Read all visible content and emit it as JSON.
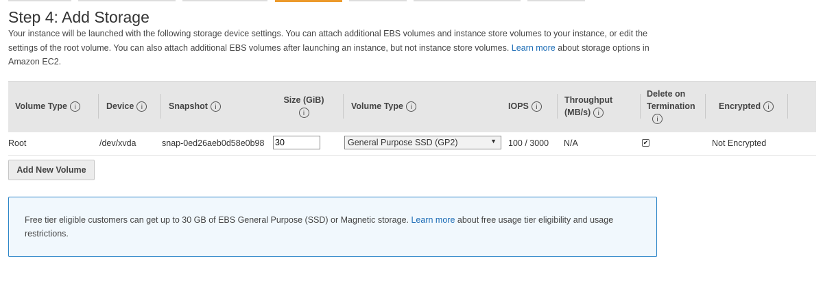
{
  "wizard": {
    "step_title": "Step 4: Add Storage",
    "description_part1": "Your instance will be launched with the following storage device settings. You can attach additional EBS volumes and instance store volumes to your instance, or edit the settings of the root volume. You can also attach additional EBS volumes after launching an instance, but not instance store volumes.",
    "learn_more_link": "Learn more",
    "description_part2": "about storage options in Amazon EC2."
  },
  "table": {
    "headers": {
      "volume_type": "Volume Type",
      "device": "Device",
      "snapshot": "Snapshot",
      "size": "Size (GiB)",
      "volume_type2": "Volume Type",
      "iops": "IOPS",
      "throughput_line1": "Throughput",
      "throughput_line2": "(MB/s)",
      "delete_line1": "Delete on",
      "delete_line2": "Termination",
      "encrypted": "Encrypted"
    },
    "row": {
      "volume_type": "Root",
      "device": "/dev/xvda",
      "snapshot": "snap-0ed26aeb0d58e0b98",
      "size": "30",
      "volume_type_selected": "General Purpose SSD (GP2)",
      "iops": "100 / 3000",
      "throughput": "N/A",
      "delete_on_termination": true,
      "encrypted": "Not Encrypted"
    },
    "info_icon_glyph": "i"
  },
  "actions": {
    "add_volume_label": "Add New Volume"
  },
  "notice": {
    "text_part1": "Free tier eligible customers can get up to 30 GB of EBS General Purpose (SSD) or Magnetic storage.",
    "learn_more_link": "Learn more",
    "text_part2": "about free usage tier eligibility and usage restrictions."
  },
  "colors": {
    "accent_tab": "#ec9a2c",
    "link": "#1a6bb5",
    "info_border": "#2a84c7",
    "info_bg": "#f1f8fd"
  }
}
